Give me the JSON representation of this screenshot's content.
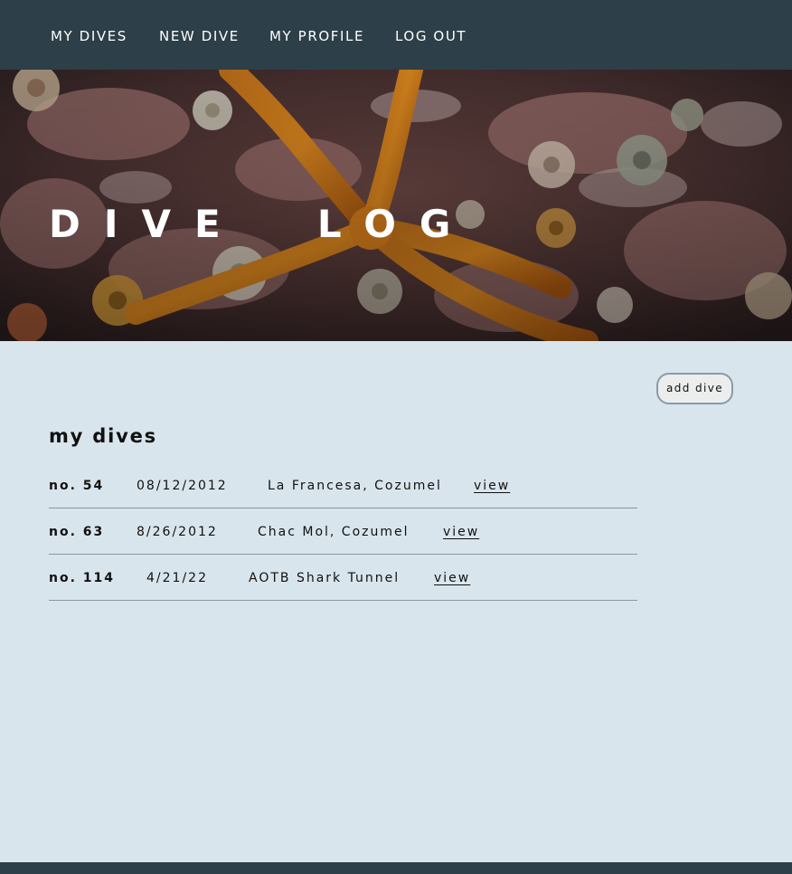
{
  "nav": {
    "items": [
      {
        "label": "MY DIVES"
      },
      {
        "label": "NEW DIVE"
      },
      {
        "label": "MY PROFILE"
      },
      {
        "label": "LOG OUT"
      }
    ]
  },
  "hero": {
    "title": "DIVE  LOG",
    "image": "starfish-reef-photo"
  },
  "main": {
    "add_button": "add dive",
    "section_title": "my dives",
    "dives": [
      {
        "number": "no. 54",
        "date": "08/12/2012",
        "location": "La Francesa, Cozumel",
        "view": "view"
      },
      {
        "number": "no. 63",
        "date": "8/26/2012",
        "location": "Chac Mol, Cozumel",
        "view": "view"
      },
      {
        "number": "no. 114",
        "date": "4/21/22",
        "location": "AOTB Shark Tunnel",
        "view": "view"
      }
    ]
  },
  "colors": {
    "nav_bg": "#2d3f48",
    "page_bg": "#d9e5ec",
    "divider": "#8f9499"
  }
}
